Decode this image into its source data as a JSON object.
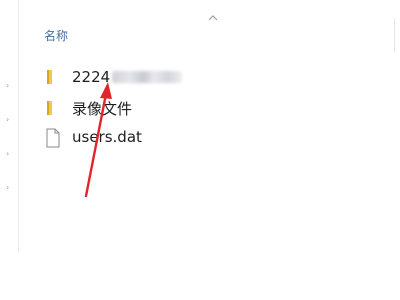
{
  "file_list": {
    "column_header": "名称",
    "rows": [
      {
        "name": "2224",
        "type": "folder",
        "name_obscured": true
      },
      {
        "name": "录像文件",
        "type": "folder"
      },
      {
        "name": "users.dat",
        "type": "file"
      }
    ]
  },
  "icons": {
    "sort": "chevron-up-icon",
    "folder": "folder-icon",
    "file": "document-icon"
  },
  "colors": {
    "folder": "#e8b73e",
    "header_text": "#4a6e9a",
    "annotation_arrow": "#e0262a"
  }
}
